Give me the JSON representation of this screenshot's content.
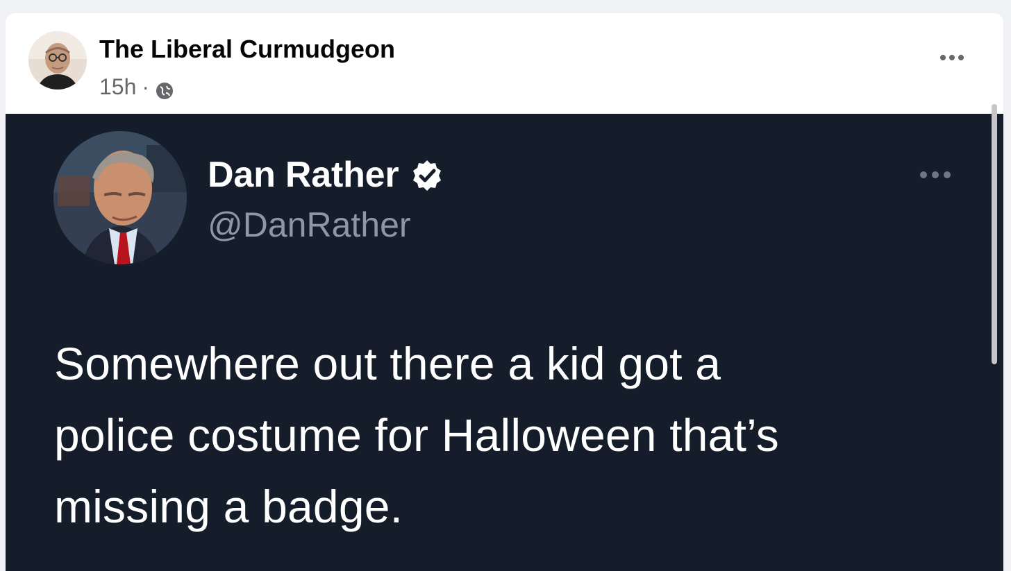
{
  "post": {
    "author": "The Liberal Curmudgeon",
    "timestamp": "15h",
    "separator": "·",
    "privacy_icon": "globe-icon",
    "menu_icon": "more-horizontal-icon"
  },
  "tweet": {
    "display_name": "Dan Rather",
    "handle": "@DanRather",
    "verified_icon": "verified-badge-icon",
    "menu_icon": "more-horizontal-icon",
    "text": "Somewhere out there a kid got a\npolice costume for Halloween that’s\nmissing a badge."
  },
  "colors": {
    "page_background": "#eff1f4",
    "card_background": "#ffffff",
    "tweet_background": "#151d2a",
    "primary_text": "#050505",
    "secondary_text": "#65676b",
    "tweet_handle": "#8d98a5"
  }
}
